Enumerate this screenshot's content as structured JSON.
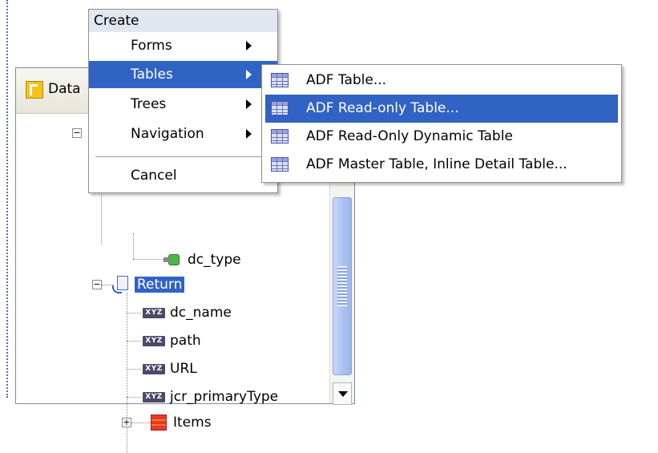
{
  "panel": {
    "title": "Data",
    "tree": [
      {
        "label": "dc_type",
        "icon": "cube-icon"
      },
      {
        "label": "Return",
        "icon": "return-icon",
        "selected": true
      },
      {
        "label": "dc_name",
        "icon": "xyz-icon"
      },
      {
        "label": "path",
        "icon": "xyz-icon"
      },
      {
        "label": "URL",
        "icon": "xyz-icon"
      },
      {
        "label": "jcr_primaryType",
        "icon": "xyz-icon"
      },
      {
        "label": "Items",
        "icon": "items-icon"
      }
    ],
    "xyz_text": "XYZ"
  },
  "menu": {
    "header": "Create",
    "items": [
      {
        "label": "Forms",
        "has_submenu": true
      },
      {
        "label": "Tables",
        "has_submenu": true,
        "active": true
      },
      {
        "label": "Trees",
        "has_submenu": true
      },
      {
        "label": "Navigation",
        "has_submenu": true
      },
      {
        "label": "Cancel",
        "has_submenu": false
      }
    ]
  },
  "submenu": {
    "items": [
      {
        "label": "ADF Table...",
        "icon": "table-icon"
      },
      {
        "label": "ADF Read-only Table...",
        "icon": "table-icon",
        "active": true
      },
      {
        "label": "ADF Read-Only Dynamic Table",
        "icon": "table-icon"
      },
      {
        "label": "ADF Master Table, Inline Detail Table...",
        "icon": "table-icon"
      }
    ]
  },
  "colors": {
    "selection": "#3163c5",
    "menu_header": "#e1e6f0"
  }
}
